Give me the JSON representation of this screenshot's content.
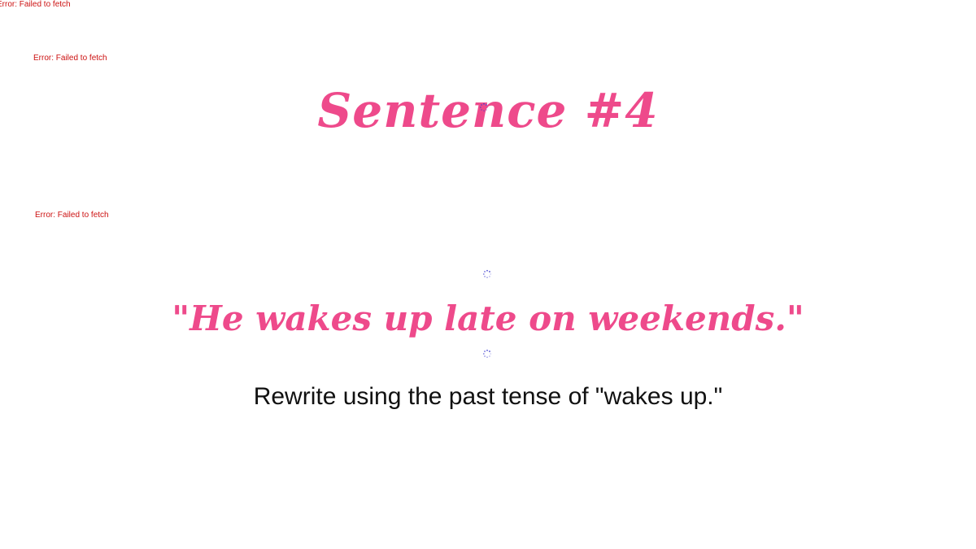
{
  "errors": [
    "Error: Failed to fetch",
    "Error: Failed to fetch",
    "Error: Failed to fetch"
  ],
  "slide": {
    "title": "Sentence #4",
    "sentence": "\"He wakes up late on weekends.\"",
    "instruction": "Rewrite using the past tense of \"wakes up.\""
  },
  "colors": {
    "accent": "#ee4a8b",
    "error": "#cc1111",
    "spinner": "#3f3fd0"
  },
  "icons": {
    "spinner": "loading-spinner-icon"
  }
}
